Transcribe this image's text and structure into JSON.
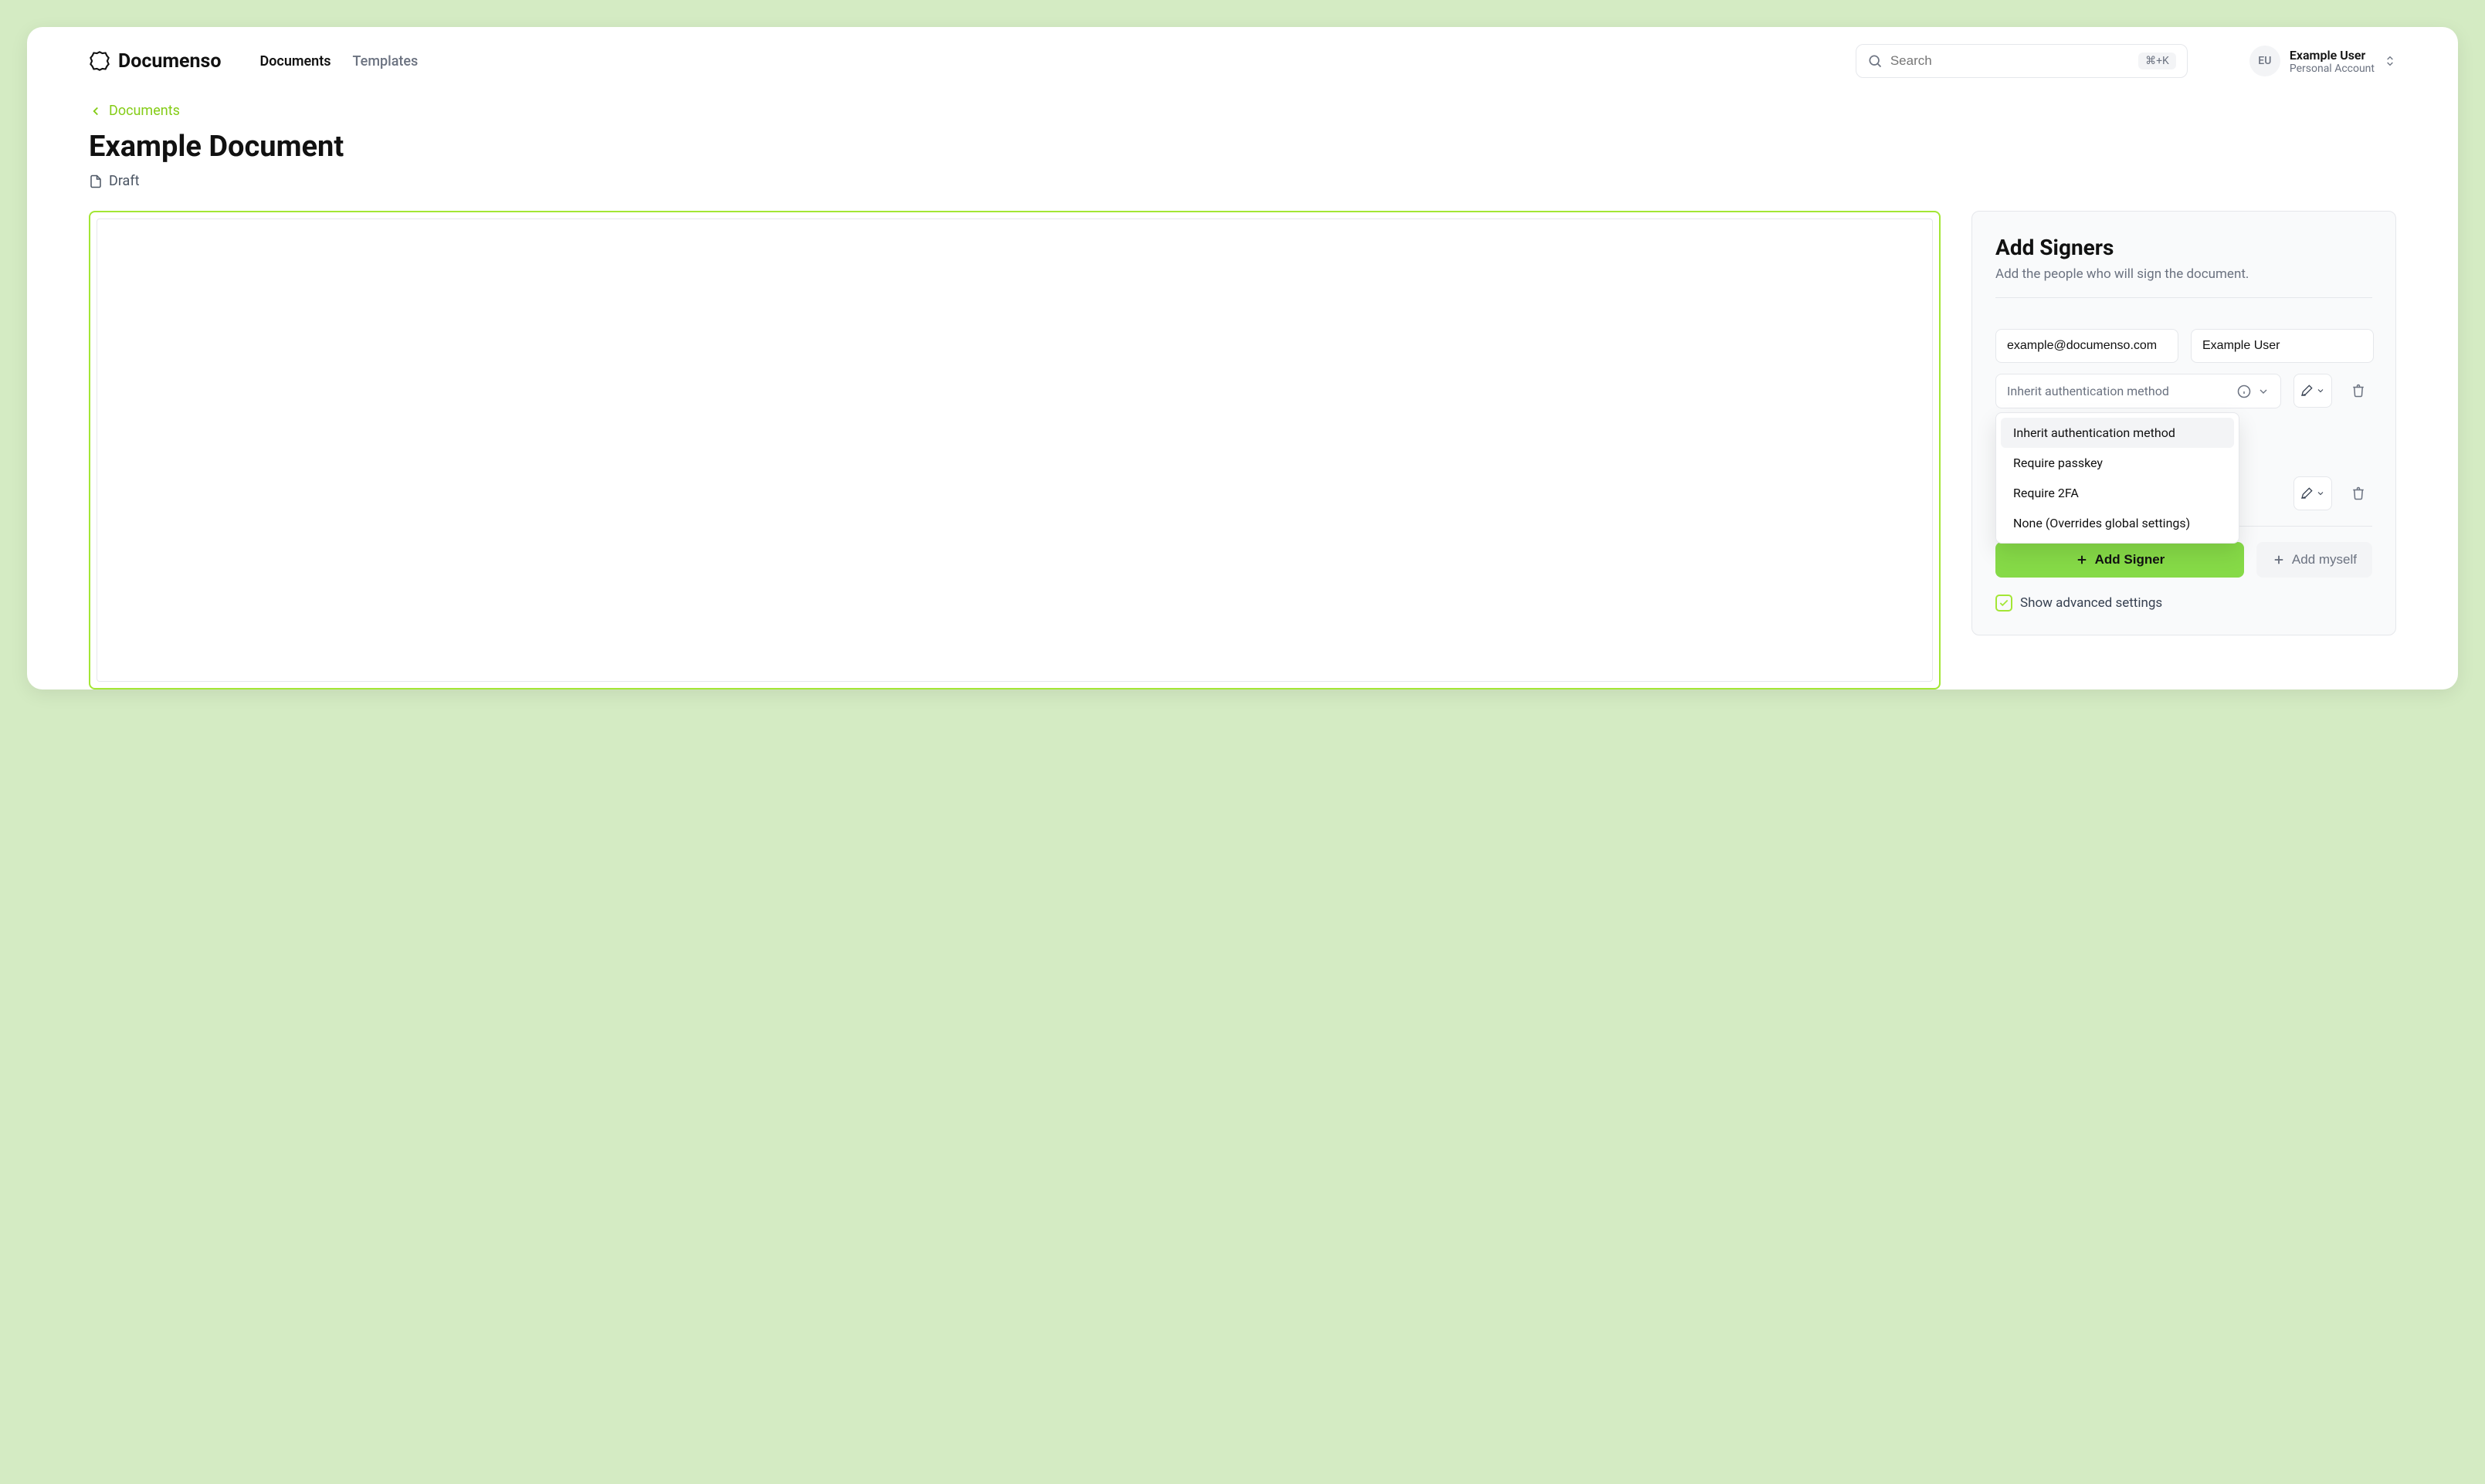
{
  "brand": "Documenso",
  "nav": {
    "documents": "Documents",
    "templates": "Templates"
  },
  "search": {
    "placeholder": "Search",
    "shortcut": "⌘+K"
  },
  "user": {
    "initials": "EU",
    "name": "Example User",
    "account": "Personal Account"
  },
  "breadcrumb": "Documents",
  "pageTitle": "Example Document",
  "status": "Draft",
  "panel": {
    "title": "Add Signers",
    "subtitle": "Add the people who will sign the document.",
    "signer1": {
      "email": "example@documenso.com",
      "name": "Example User"
    },
    "authPlaceholder": "Inherit authentication method",
    "authOptions": [
      "Inherit authentication method",
      "Require passkey",
      "Require 2FA",
      "None (Overrides global settings)"
    ],
    "addSigner": "Add Signer",
    "addMyself": "Add myself",
    "advancedSettings": "Show advanced settings"
  }
}
